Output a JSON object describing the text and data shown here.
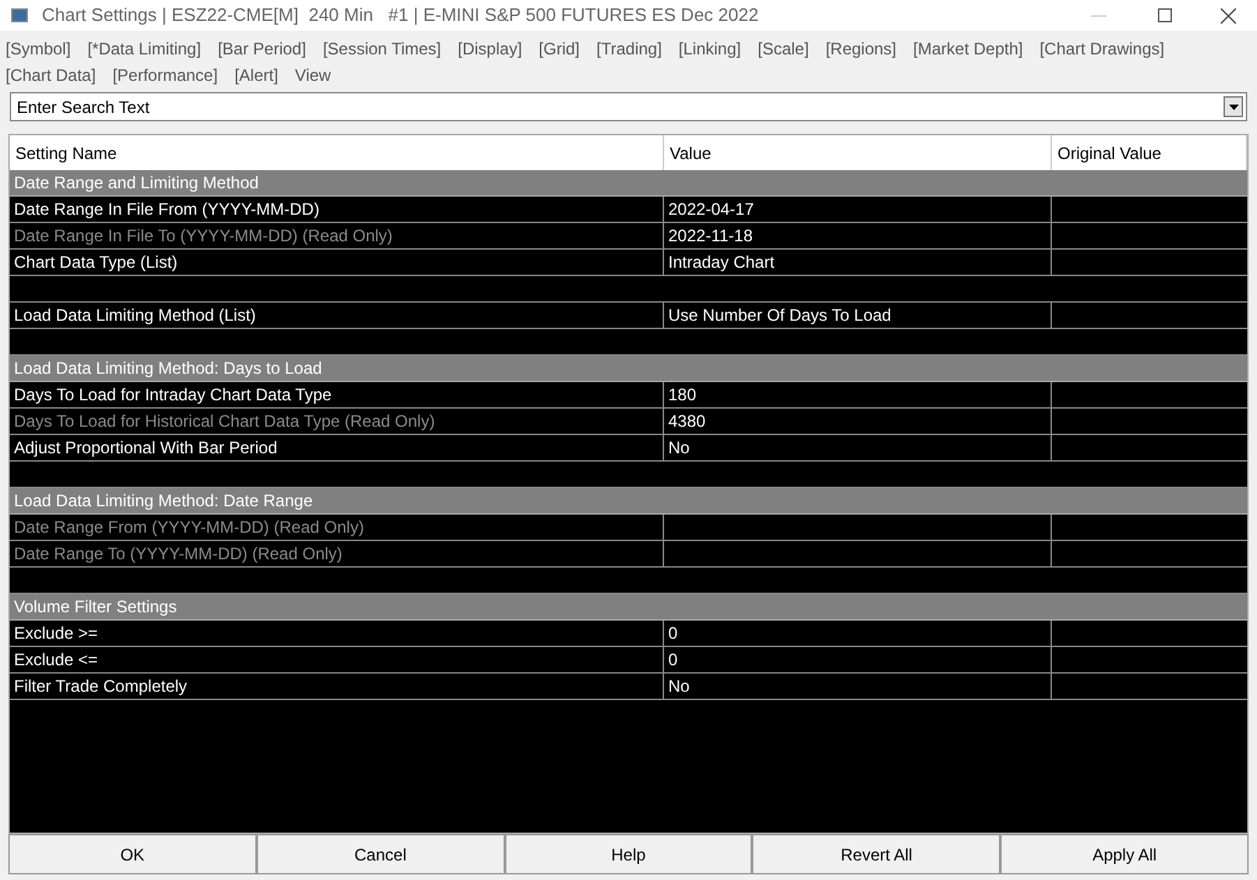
{
  "window": {
    "title": "Chart Settings | ESZ22-CME[M]  240 Min   #1 | E-MINI S&P 500 FUTURES ES Dec 2022"
  },
  "tabs": [
    "[Symbol]",
    "[*Data Limiting]",
    "[Bar Period]",
    "[Session Times]",
    "[Display]",
    "[Grid]",
    "[Trading]",
    "[Linking]",
    "[Scale]",
    "[Regions]",
    "[Market Depth]",
    "[Chart Drawings]",
    "[Chart Data]",
    "[Performance]",
    "[Alert]",
    "View"
  ],
  "search": {
    "value": "Enter Search Text"
  },
  "table": {
    "columns": [
      "Setting Name",
      "Value",
      "Original Value"
    ],
    "rows": [
      {
        "kind": "section",
        "name": "Date Range and Limiting Method"
      },
      {
        "kind": "setting",
        "name": "Date Range In File From (YYYY-MM-DD)",
        "value": "2022-04-17",
        "read_only": false
      },
      {
        "kind": "setting",
        "name": "Date Range In File To (YYYY-MM-DD) (Read Only)",
        "value": "2022-11-18",
        "read_only": true
      },
      {
        "kind": "setting",
        "name": "Chart Data Type (List)",
        "value": "Intraday Chart",
        "read_only": false
      },
      {
        "kind": "blank"
      },
      {
        "kind": "setting",
        "name": "Load Data Limiting Method (List)",
        "value": "Use Number Of Days To Load",
        "read_only": false
      },
      {
        "kind": "blank"
      },
      {
        "kind": "section",
        "name": "Load Data Limiting Method: Days to Load"
      },
      {
        "kind": "setting",
        "name": "Days To Load for Intraday Chart Data Type",
        "value": "180",
        "read_only": false
      },
      {
        "kind": "setting",
        "name": "Days To Load for Historical Chart Data Type (Read Only)",
        "value": "4380",
        "read_only": true
      },
      {
        "kind": "setting",
        "name": "Adjust Proportional With Bar Period",
        "value": "No",
        "read_only": false
      },
      {
        "kind": "blank"
      },
      {
        "kind": "section",
        "name": "Load Data Limiting Method: Date Range"
      },
      {
        "kind": "setting",
        "name": "Date Range From (YYYY-MM-DD) (Read Only)",
        "read_only": true
      },
      {
        "kind": "setting",
        "name": "Date Range To (YYYY-MM-DD) (Read Only)",
        "read_only": true
      },
      {
        "kind": "blank"
      },
      {
        "kind": "section",
        "name": "Volume Filter Settings"
      },
      {
        "kind": "setting",
        "name": "Exclude >=",
        "value": "0",
        "read_only": false
      },
      {
        "kind": "setting",
        "name": "Exclude <=",
        "value": "0",
        "read_only": false
      },
      {
        "kind": "setting",
        "name": "Filter Trade Completely",
        "value": "No",
        "read_only": false
      }
    ]
  },
  "buttons": [
    "OK",
    "Cancel",
    "Help",
    "Revert All",
    "Apply All"
  ]
}
